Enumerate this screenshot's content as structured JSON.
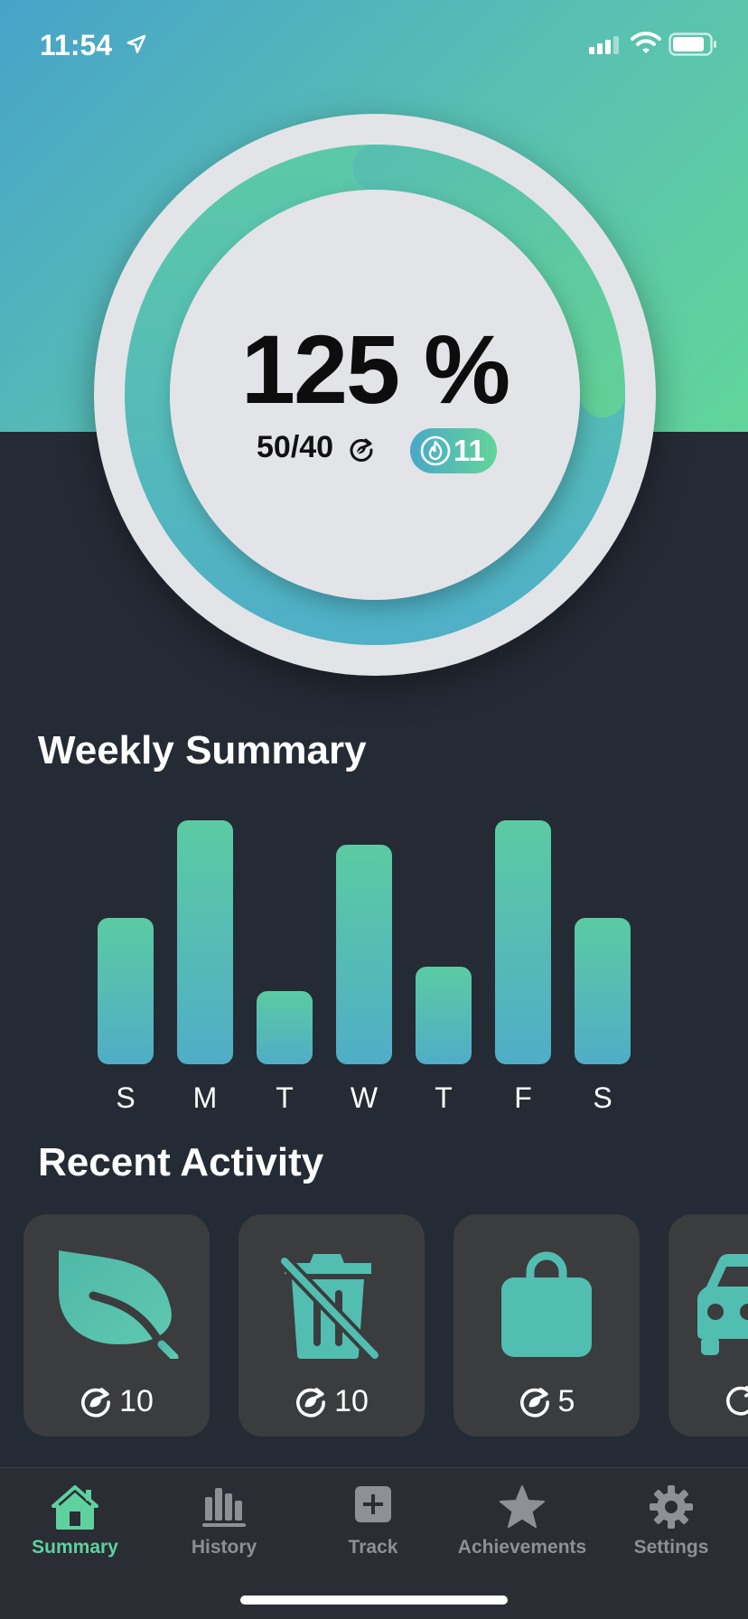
{
  "status_bar": {
    "time": "11:54"
  },
  "summary": {
    "percent": "125 %",
    "progress": "50/40",
    "progress_fraction": 1.25,
    "streak": "11"
  },
  "weekly_summary": {
    "title": "Weekly Summary"
  },
  "chart_data": {
    "type": "bar",
    "categories": [
      "S",
      "M",
      "T",
      "W",
      "T",
      "F",
      "S"
    ],
    "values": [
      0.6,
      1.0,
      0.3,
      0.9,
      0.4,
      1.0,
      0.6
    ],
    "title": "",
    "xlabel": "",
    "ylabel": "",
    "ylim": [
      0,
      1
    ],
    "grid": false
  },
  "recent_activity": {
    "title": "Recent Activity",
    "cards": [
      {
        "icon": "leaf-icon",
        "value": "10"
      },
      {
        "icon": "no-trash-icon",
        "value": "10"
      },
      {
        "icon": "bag-icon",
        "value": "5"
      },
      {
        "icon": "car-icon",
        "value": ""
      }
    ]
  },
  "tab_bar": {
    "items": [
      {
        "label": "Summary",
        "icon": "home-icon",
        "active": true
      },
      {
        "label": "History",
        "icon": "history-icon",
        "active": false
      },
      {
        "label": "Track",
        "icon": "plus-square-icon",
        "active": false
      },
      {
        "label": "Achievements",
        "icon": "star-icon",
        "active": false
      },
      {
        "label": "Settings",
        "icon": "gear-icon",
        "active": false
      }
    ]
  },
  "colors": {
    "accent_green": "#5fd19f",
    "accent_blue": "#4aa8c8",
    "background": "#252b35",
    "card": "#3a3c3e"
  }
}
